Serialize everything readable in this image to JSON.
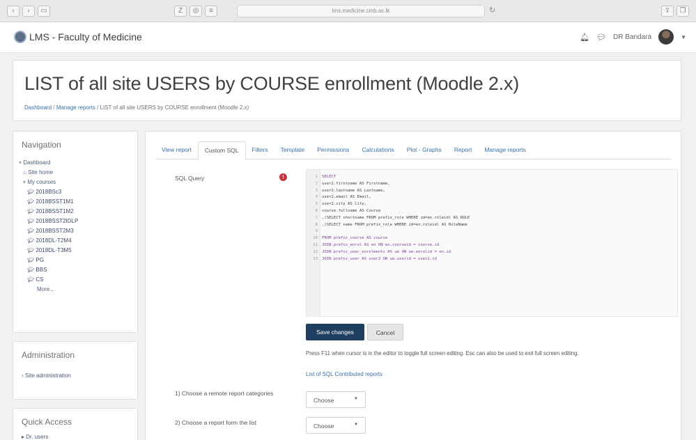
{
  "browser": {
    "url": "lms.medicine.cmb.ac.lk",
    "reload_icon": "reload-icon"
  },
  "navbar": {
    "site_name": "LMS - Faculty of Medicine",
    "user_name": "DR Bandara",
    "bell_icon": "bell-icon",
    "chat_icon": "chat-icon"
  },
  "header": {
    "title": "LIST of all site USERS by COURSE enrollment (Moodle 2.x)",
    "breadcrumb": {
      "home": "Dashboard",
      "sep1": " / ",
      "reports": "Manage reports",
      "sep2": " / ",
      "current": "LIST of all site USERS by COURSE enrollment (Moodle 2.x)"
    }
  },
  "navigation": {
    "title": "Navigation",
    "dashboard": "Dashboard",
    "site_home": "Site home",
    "my_courses": "My courses",
    "courses": [
      "2018BSc3",
      "2018BSST1M1",
      "2018BSST1M2",
      "2018BSST2IDLP",
      "2018BSST2M3",
      "2018DL-T2M4",
      "2018DL-T3M5",
      "PG",
      "BBS",
      "CS"
    ],
    "more": "More..."
  },
  "administration": {
    "title": "Administration",
    "item": "Site administration"
  },
  "quick_access": {
    "title": "Quick Access",
    "item": "Dr. users"
  },
  "tabs": [
    "View report",
    "Custom SQL",
    "Filters",
    "Template",
    "Permissions",
    "Calculations",
    "Plot - Graphs",
    "Report",
    "Manage reports"
  ],
  "active_tab": "Custom SQL",
  "form": {
    "sql_label": "SQL Query",
    "save_label": "Save changes",
    "cancel_label": "Cancel",
    "help_text": "Press F11 when cursor is in the editor to toggle full screen editing. Esc can also be used to exit full screen editing.",
    "link_text": "List of SQL Contributed reports",
    "remote_label": "1) Choose a remote report categories",
    "remote_value": "Choose",
    "report_label": "2) Choose a report form the list",
    "report_value": "Choose"
  },
  "sql_lines": [
    "SELECT",
    "user2.firstname AS Firstname,",
    "user2.lastname AS Lastname,",
    "user2.email AS Email,",
    "user2.city AS City,",
    "course.fullname AS Course",
    ",(SELECT shortname FROM prefix_role WHERE id=en.roleid) AS ROLE",
    ",(SELECT name FROM prefix_role WHERE id=en.roleid) AS RoleName",
    "",
    "FROM prefix_course AS course",
    "JOIN prefix_enrol AS en ON en.courseid = course.id",
    "JOIN prefix_user_enrolments AS ue ON ue.enrolid = en.id",
    "JOIN prefix_user AS user2 ON ue.userid = user2.id"
  ],
  "colors": {
    "primary_button": "#1f3f61",
    "link": "#3a6fa8",
    "error": "#c8313a"
  }
}
